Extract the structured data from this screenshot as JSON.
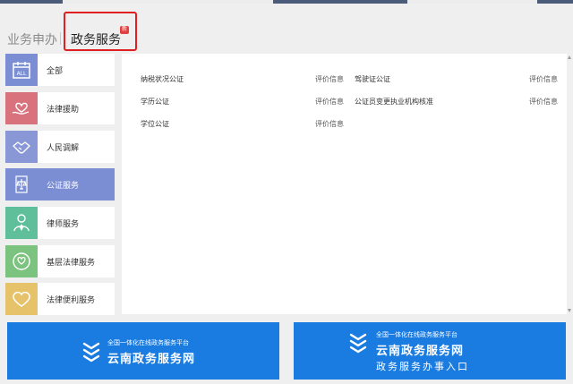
{
  "tabs": {
    "inactive_label": "业务申办",
    "active_label": "政务服务",
    "active_badge": "新"
  },
  "sidebar": {
    "items": [
      {
        "label": "全部",
        "icon": "calendar-all-icon",
        "icon_text": "ALL",
        "color": "#7b8ed3",
        "active": false
      },
      {
        "label": "法律援助",
        "icon": "heart-hand-icon",
        "color": "#d8737e",
        "active": false
      },
      {
        "label": "人民调解",
        "icon": "handshake-icon",
        "color": "#8a97d6",
        "active": false
      },
      {
        "label": "公证服务",
        "icon": "scales-icon",
        "color": "#7b8ed3",
        "active": true
      },
      {
        "label": "律师服务",
        "icon": "lawyer-icon",
        "color": "#5fbf9a",
        "active": false
      },
      {
        "label": "基层法律服务",
        "icon": "heart-circle-icon",
        "color": "#7cc37f",
        "active": false
      },
      {
        "label": "法律便利服务",
        "icon": "heart-outline-icon",
        "color": "#e6c36b",
        "active": false
      }
    ]
  },
  "services": {
    "link_label": "评价信息",
    "rows": [
      [
        "纳税状况公证",
        "驾驶证公证"
      ],
      [
        "学历公证",
        "公证员变更执业机构核准"
      ],
      [
        "学位公证"
      ]
    ]
  },
  "banners": {
    "left": {
      "kicker": "全国一体化在线政务服务平台",
      "title": "云南政务服务网"
    },
    "right": {
      "kicker": "全国一体化在线政务服务平台",
      "title": "云南政务服务网",
      "subtitle": "政务服务办事入口"
    }
  },
  "colors": {
    "accent": "#7b8ed3",
    "banner_blue": "#1a7be0",
    "highlight_red": "#e02020"
  }
}
